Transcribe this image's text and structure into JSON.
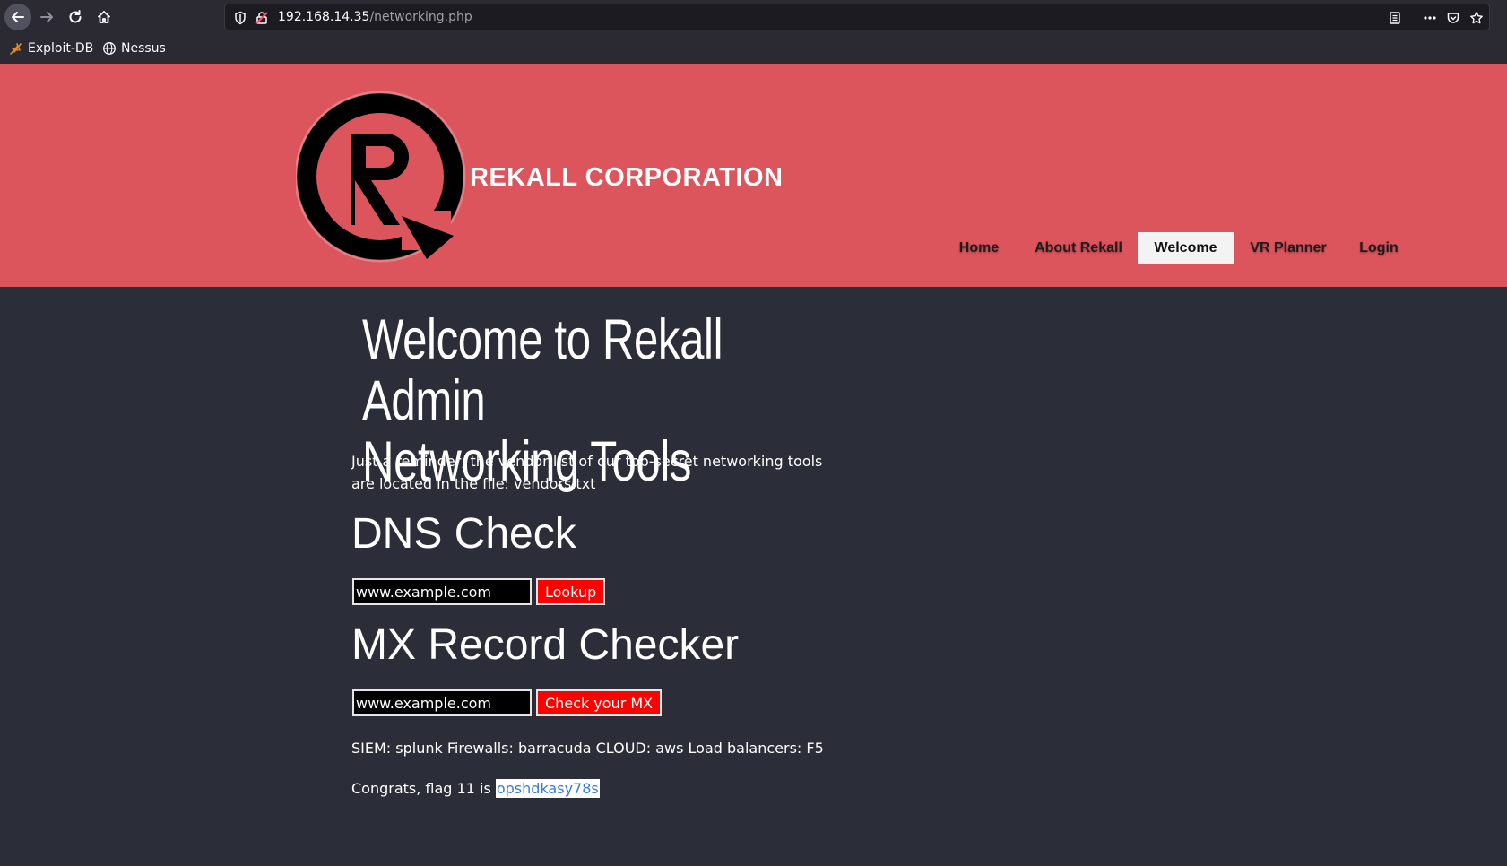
{
  "browser": {
    "url_host": "192.168.14.35",
    "url_path": "/networking.php",
    "bookmarks": [
      "Exploit-DB",
      "Nessus"
    ]
  },
  "header": {
    "brand": "REKALL CORPORATION",
    "nav": [
      {
        "label": "Home",
        "active": false
      },
      {
        "label": "About Rekall",
        "active": false
      },
      {
        "label": "Welcome",
        "active": true
      },
      {
        "label": "VR Planner",
        "active": false
      },
      {
        "label": "Login",
        "active": false
      }
    ]
  },
  "main": {
    "title_line1": "Welcome to Rekall Admin",
    "title_line2": "Networking Tools",
    "reminder": "Just a reminder, the vendor list of our top-secret networking tools are located in the file: vendors.txt",
    "dns": {
      "heading": "DNS Check",
      "input_value": "www.example.com",
      "button": "Lookup"
    },
    "mx": {
      "heading": "MX Record Checker",
      "input_value": "www.example.com",
      "button": "Check your MX"
    },
    "vendors_line": "SIEM: splunk Firewalls: barracuda CLOUD: aws Load balancers: F5",
    "flag_prefix": "Congrats, flag 11 is ",
    "flag_value": "opshdkasy78s"
  },
  "colors": {
    "header_bg": "#dc545c",
    "page_bg": "#2b2e38",
    "button_red": "#ff0000"
  }
}
